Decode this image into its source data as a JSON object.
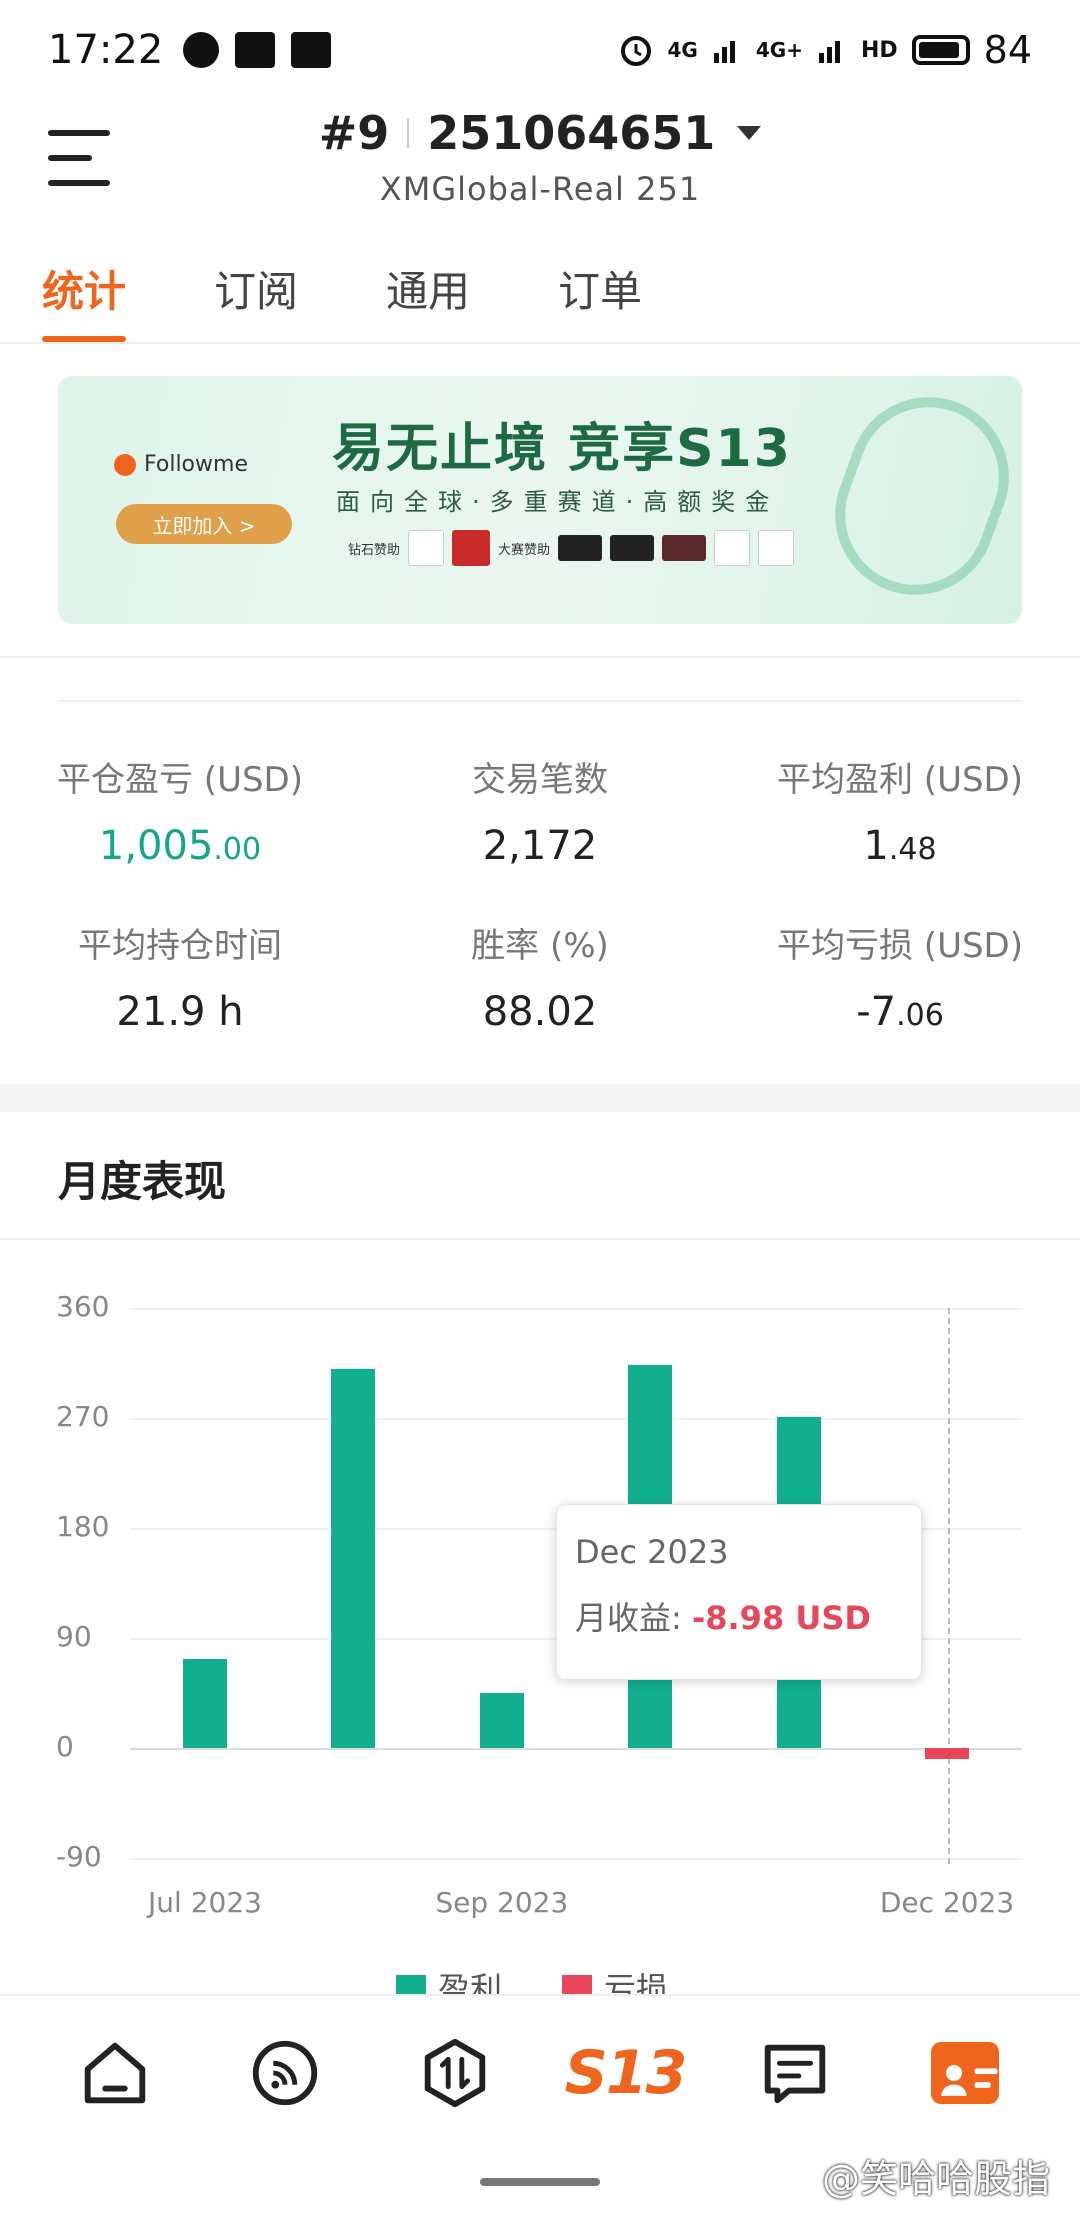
{
  "status_bar": {
    "time": "17:22",
    "net1": "4G",
    "net2": "4G+",
    "hd": "HD",
    "battery": "84"
  },
  "header": {
    "account_index": "#9",
    "account_number": "251064651",
    "server": "XMGlobal-Real 251"
  },
  "tabs": [
    "统计",
    "订阅",
    "通用",
    "订单"
  ],
  "banner": {
    "brand": "Followme",
    "button": "立即加入 >",
    "title": "易无止境 竞享S13",
    "subtitle": "面向全球·多重赛道·高额奖金",
    "sponsor_label": "钻石赞助",
    "sponsor_label2": "大赛赞助"
  },
  "stats": {
    "closed_pnl": {
      "label": "平仓盈亏 (USD)",
      "int": "1,005",
      "dec": ".00"
    },
    "trades": {
      "label": "交易笔数",
      "value": "2,172"
    },
    "avg_profit": {
      "label": "平均盈利 (USD)",
      "int": "1",
      "dec": ".48"
    },
    "avg_hold": {
      "label": "平均持仓时间",
      "value": "21.9 h"
    },
    "win_rate": {
      "label": "胜率 (%)",
      "value": "88.02"
    },
    "avg_loss": {
      "label": "平均亏损 (USD)",
      "int": "-7",
      "dec": ".06"
    }
  },
  "monthly": {
    "title": "月度表现"
  },
  "chart_data": {
    "type": "bar",
    "categories": [
      "Jul 2023",
      "Aug 2023",
      "Sep 2023",
      "Oct 2023",
      "Nov 2023",
      "Dec 2023"
    ],
    "x_tick_labels": [
      "Jul 2023",
      "Sep 2023",
      "Dec 2023"
    ],
    "values": [
      73,
      310,
      45,
      313,
      271,
      -8.98
    ],
    "y_ticks": [
      "360",
      "270",
      "180",
      "90",
      "0",
      "-90"
    ],
    "ylim": [
      -90,
      360
    ],
    "grid": true,
    "legend": [
      {
        "name": "盈利",
        "color": "#12b08f"
      },
      {
        "name": "亏损",
        "color": "#e8475b"
      }
    ],
    "legend_position": "bottom",
    "tooltip": {
      "date": "Dec 2023",
      "label": "月收益:",
      "value": "-8.98 USD"
    }
  },
  "nav": {
    "s13_label": "S13"
  },
  "watermark": "@笑哈哈股指"
}
